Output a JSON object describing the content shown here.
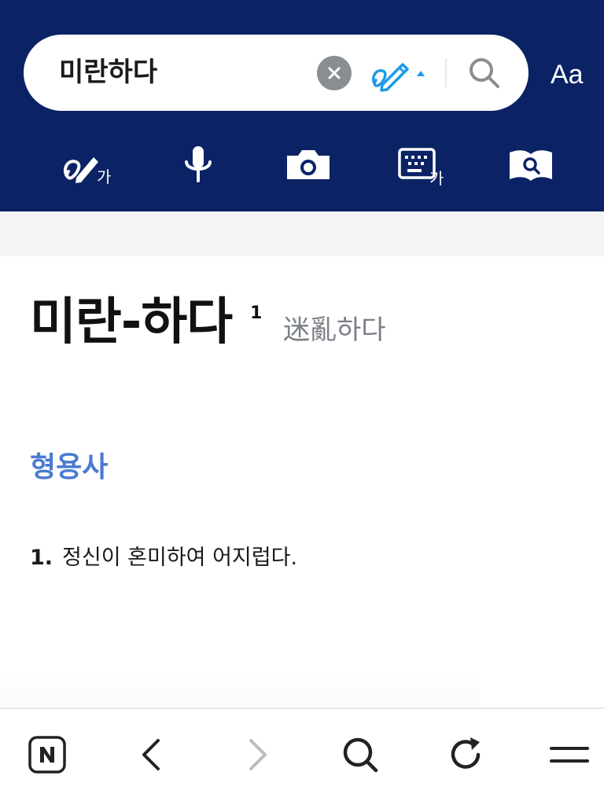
{
  "search": {
    "query": "미란하다",
    "font_button_label": "Aa",
    "handwriting_glyph": "가",
    "keyboard_glyph": "가"
  },
  "toolbar": {
    "tools": [
      {
        "name": "handwriting-input",
        "icon": "pen-handwriting-icon"
      },
      {
        "name": "voice-search",
        "icon": "microphone-icon"
      },
      {
        "name": "image-search",
        "icon": "camera-icon"
      },
      {
        "name": "keyboard-input",
        "icon": "keyboard-icon"
      },
      {
        "name": "dictionary-lens",
        "icon": "book-search-icon"
      }
    ]
  },
  "entry": {
    "headword": "미란-하다",
    "superscript": "1",
    "hanja": "迷亂하다",
    "part_of_speech": "형용사",
    "definitions": [
      {
        "number": "1.",
        "text": "정신이 혼미하여 어지럽다."
      }
    ]
  },
  "bottom_nav": {
    "items": [
      {
        "name": "home",
        "icon": "naver-n-icon"
      },
      {
        "name": "back",
        "icon": "chevron-left-icon"
      },
      {
        "name": "forward",
        "icon": "chevron-right-icon"
      },
      {
        "name": "search",
        "icon": "search-icon"
      },
      {
        "name": "refresh",
        "icon": "refresh-icon"
      },
      {
        "name": "menu",
        "icon": "hamburger-menu-icon"
      }
    ]
  },
  "colors": {
    "header_bg": "#0b2265",
    "accent_blue": "#4a7bd0",
    "handwriting_blue": "#1e9be8",
    "band_gray": "#f3f4f6"
  }
}
